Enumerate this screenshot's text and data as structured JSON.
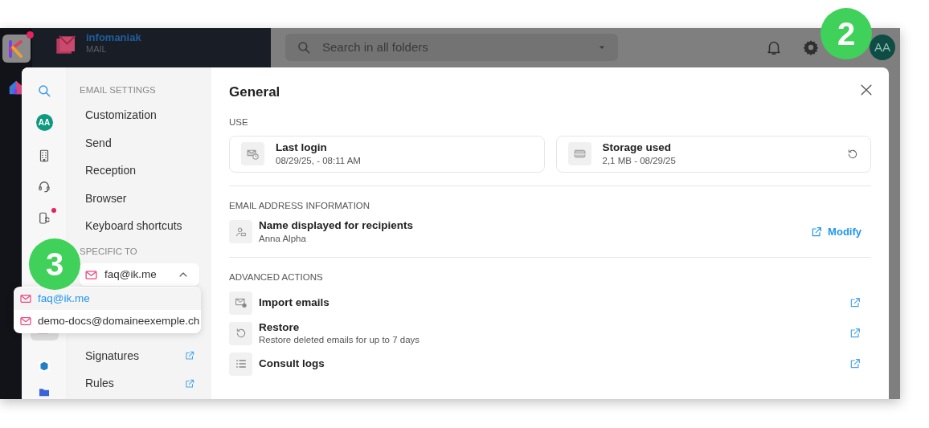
{
  "app_header": {
    "brand": "infomaniak",
    "product": "MAIL",
    "search_placeholder": "Search in all folders",
    "avatar": "AA",
    "logo_notification": true
  },
  "settings_rail": {
    "avatar": "AA",
    "sync_notification": true
  },
  "settings_menu": {
    "section_1": "EMAIL SETTINGS",
    "items": [
      {
        "label": "Customization"
      },
      {
        "label": "Send"
      },
      {
        "label": "Reception"
      },
      {
        "label": "Browser"
      },
      {
        "label": "Keyboard shortcuts"
      }
    ],
    "section_2": "SPECIFIC TO",
    "account_select": {
      "value": "faq@ik.me",
      "expanded": true,
      "options": [
        {
          "label": "faq@ik.me",
          "selected": true
        },
        {
          "label": "demo-docs@domaineexemple.ch",
          "selected": false
        }
      ]
    },
    "links": [
      {
        "label": "Signatures",
        "external": true
      },
      {
        "label": "Rules",
        "external": true
      }
    ]
  },
  "panel": {
    "title": "General",
    "sections": [
      {
        "heading": "USE",
        "kind": "cards",
        "cards": [
          {
            "title": "Last login",
            "subtitle": "08/29/25, - 08:11 AM",
            "refresh": false
          },
          {
            "title": "Storage used",
            "subtitle": "2,1 MB - 08/29/25",
            "refresh": true
          }
        ]
      },
      {
        "heading": "EMAIL ADDRESS INFORMATION",
        "kind": "rows",
        "rows": [
          {
            "title": "Name displayed for recipients",
            "subtitle": "Anna Alpha",
            "action": "Modify"
          }
        ]
      },
      {
        "heading": "ADVANCED ACTIONS",
        "kind": "rows",
        "rows": [
          {
            "title": "Import emails",
            "external": true
          },
          {
            "title": "Restore",
            "subtitle": "Restore deleted emails for up to 7 days",
            "external": true
          },
          {
            "title": "Consult logs",
            "external": true
          }
        ]
      }
    ]
  },
  "callouts": [
    {
      "number": "2"
    },
    {
      "number": "3"
    }
  ]
}
